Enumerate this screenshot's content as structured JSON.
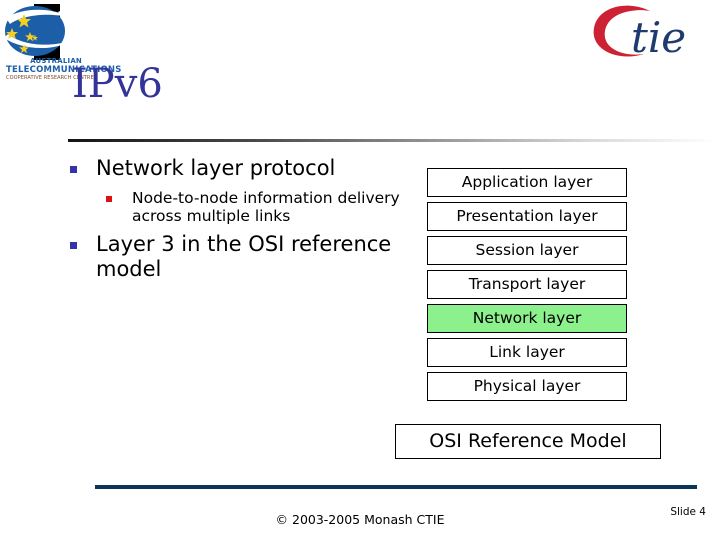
{
  "brand": {
    "accent_title": "#333399",
    "bullet_level1_color": "#3333aa",
    "bullet_level2_color": "#dd1111",
    "highlight_color": "#8cf08c",
    "footer_rule_color": "#0b3558",
    "ctie_c_color": "#cc2233",
    "ctie_text_color": "#1f3a6e"
  },
  "logo_left": {
    "name": "atcrc-logo",
    "line1": "AUSTRALIAN",
    "line2": "TELECOMMUNICATIONS",
    "line3": "COOPERATIVE RESEARCH CENTRE"
  },
  "logo_right": {
    "name": "ctie-logo",
    "letter_c": "C",
    "word": "tie"
  },
  "title": "IPv6",
  "bullets": [
    {
      "level": 1,
      "text": "Network layer protocol"
    },
    {
      "level": 2,
      "text": "Node-to-node information delivery across multiple links"
    },
    {
      "level": 1,
      "text": "Layer 3 in the OSI reference model"
    }
  ],
  "osi_stack": {
    "caption": "OSI Reference Model",
    "layers": [
      {
        "label": "Application layer",
        "highlighted": false
      },
      {
        "label": "Presentation layer",
        "highlighted": false
      },
      {
        "label": "Session layer",
        "highlighted": false
      },
      {
        "label": "Transport layer",
        "highlighted": false
      },
      {
        "label": "Network layer",
        "highlighted": true
      },
      {
        "label": "Link layer",
        "highlighted": false
      },
      {
        "label": "Physical layer",
        "highlighted": false
      }
    ]
  },
  "footer": {
    "copyright": "© 2003-2005 Monash CTIE",
    "slide_number": "Slide 4"
  }
}
